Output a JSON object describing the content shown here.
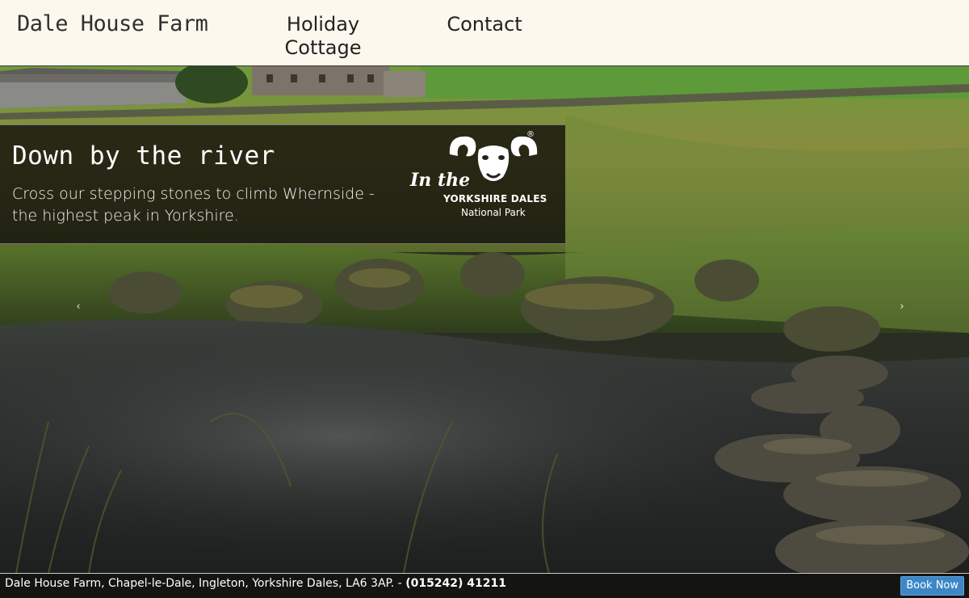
{
  "header": {
    "site_title": "Dale House Farm",
    "nav": [
      {
        "label_line1": "Holiday",
        "label_line2": "Cottage"
      },
      {
        "label_line1": "Contact"
      }
    ]
  },
  "slide": {
    "title": "Down by the river",
    "text": "Cross our stepping stones to climb Whernside - the highest peak in Yorkshire.",
    "logo": {
      "in_the": "In the",
      "name": "YORKSHIRE DALES",
      "subtitle": "National Park",
      "registered": "®"
    },
    "prev_arrow_icon": "chevron-left-icon",
    "next_arrow_icon": "chevron-right-icon",
    "prev_arrow_glyph": "‹",
    "next_arrow_glyph": "›"
  },
  "footer": {
    "address": "Dale House Farm, Chapel-le-Dale, Ingleton, Yorkshire Dales, LA6 3AP. - ",
    "phone": "(015242) 41211",
    "book_label": "Book Now"
  },
  "colors": {
    "header_bg": "#fdf8ee",
    "book_button": "#3d87c7",
    "footer_bg": "#141510"
  }
}
